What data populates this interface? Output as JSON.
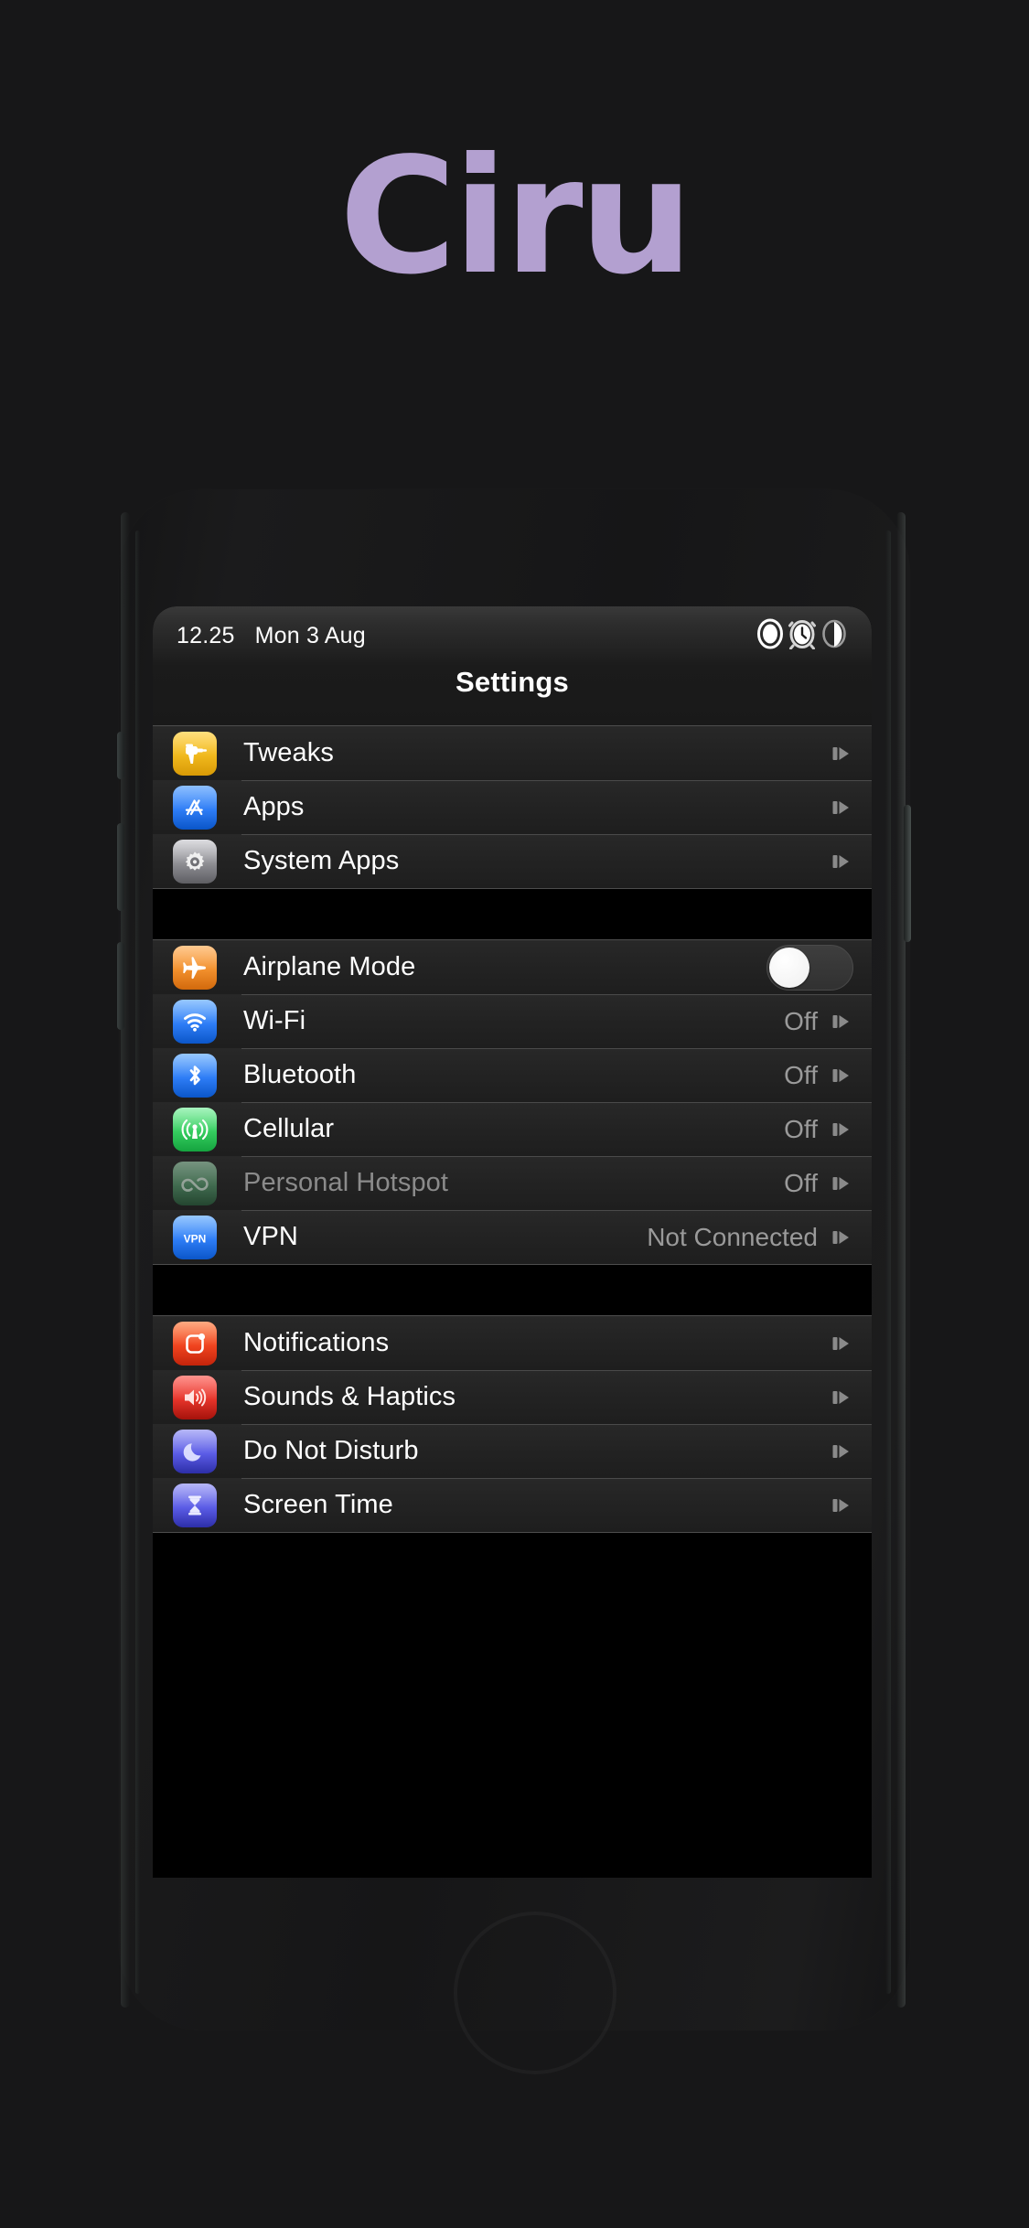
{
  "brand": {
    "wordmark": "Ciru"
  },
  "status_bar": {
    "time": "12.25",
    "date": "Mon 3 Aug",
    "icons": [
      {
        "name": "rotation-lock-icon",
        "label": "Rotation Lock"
      },
      {
        "name": "alarm-clock-icon",
        "label": "Alarm"
      },
      {
        "name": "do-not-disturb-contrast-icon",
        "label": "Do Not Disturb"
      }
    ]
  },
  "nav": {
    "title": "Settings"
  },
  "colors": {
    "brand_purple": "#b3a0d0",
    "row_bg": "#232323",
    "separator": "#4a4a4a",
    "value_text": "#9a9a9a",
    "disabled_text": "#8b8b8b",
    "icon_tweaks": "#f0b81c",
    "icon_apps": "#2e7df6",
    "icon_system_apps": "#8e8e93",
    "icon_airplane": "#f2902d",
    "icon_wifi": "#2e7df6",
    "icon_bluetooth": "#2e7df6",
    "icon_cellular": "#35cd5f",
    "icon_hotspot": "#35a05a",
    "icon_vpn": "#2e7df6",
    "icon_notifications": "#f0441f",
    "icon_sounds": "#e5342a",
    "icon_dnd": "#5b5ce6",
    "icon_screentime": "#5b5ce6"
  },
  "groups": [
    {
      "id": "group-shortcuts",
      "rows": [
        {
          "name": "tweaks",
          "label": "Tweaks",
          "icon": "drill-icon",
          "accessory": "disclosure",
          "value": ""
        },
        {
          "name": "apps",
          "label": "Apps",
          "icon": "app-store-icon",
          "accessory": "disclosure",
          "value": ""
        },
        {
          "name": "system-apps",
          "label": "System Apps",
          "icon": "gear-icon",
          "accessory": "disclosure",
          "value": ""
        }
      ]
    },
    {
      "id": "group-connectivity",
      "rows": [
        {
          "name": "airplane-mode",
          "label": "Airplane Mode",
          "icon": "airplane-icon",
          "accessory": "toggle",
          "value": "",
          "toggle_on": false
        },
        {
          "name": "wifi",
          "label": "Wi-Fi",
          "icon": "wifi-icon",
          "accessory": "disclosure",
          "value": "Off"
        },
        {
          "name": "bluetooth",
          "label": "Bluetooth",
          "icon": "bluetooth-icon",
          "accessory": "disclosure",
          "value": "Off"
        },
        {
          "name": "cellular",
          "label": "Cellular",
          "icon": "cellular-icon",
          "accessory": "disclosure",
          "value": "Off"
        },
        {
          "name": "personal-hotspot",
          "label": "Personal Hotspot",
          "icon": "hotspot-icon",
          "accessory": "disclosure",
          "value": "Off",
          "disabled": true
        },
        {
          "name": "vpn",
          "label": "VPN",
          "icon": "vpn-icon",
          "accessory": "disclosure",
          "value": "Not Connected"
        }
      ]
    },
    {
      "id": "group-notifications",
      "rows": [
        {
          "name": "notifications",
          "label": "Notifications",
          "icon": "notification-banner-icon",
          "accessory": "disclosure",
          "value": ""
        },
        {
          "name": "sounds-haptics",
          "label": "Sounds & Haptics",
          "icon": "speaker-icon",
          "accessory": "disclosure",
          "value": ""
        },
        {
          "name": "do-not-disturb",
          "label": "Do Not Disturb",
          "icon": "moon-icon",
          "accessory": "disclosure",
          "value": ""
        },
        {
          "name": "screen-time",
          "label": "Screen Time",
          "icon": "hourglass-icon",
          "accessory": "disclosure",
          "value": ""
        }
      ]
    }
  ]
}
